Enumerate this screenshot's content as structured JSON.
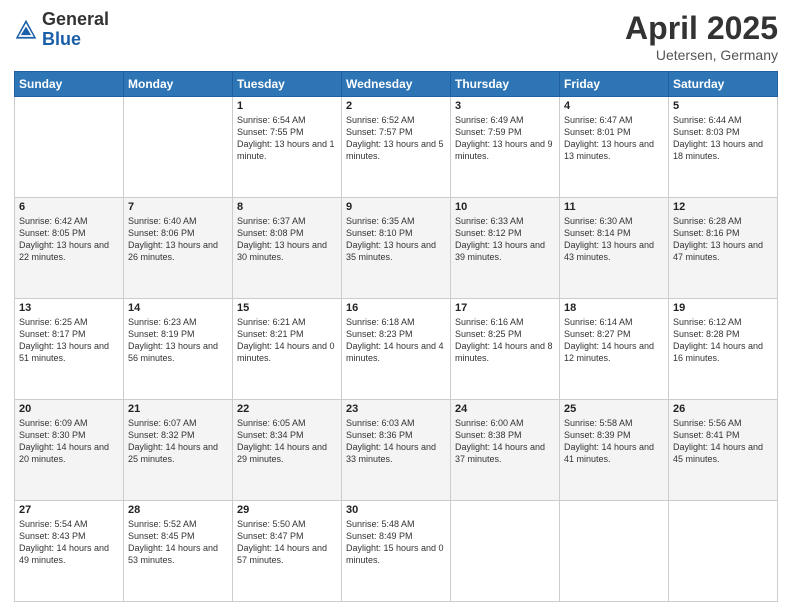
{
  "header": {
    "logo_general": "General",
    "logo_blue": "Blue",
    "title": "April 2025",
    "location": "Uetersen, Germany"
  },
  "weekdays": [
    "Sunday",
    "Monday",
    "Tuesday",
    "Wednesday",
    "Thursday",
    "Friday",
    "Saturday"
  ],
  "weeks": [
    [
      {
        "day": "",
        "info": ""
      },
      {
        "day": "",
        "info": ""
      },
      {
        "day": "1",
        "info": "Sunrise: 6:54 AM\nSunset: 7:55 PM\nDaylight: 13 hours and 1 minute."
      },
      {
        "day": "2",
        "info": "Sunrise: 6:52 AM\nSunset: 7:57 PM\nDaylight: 13 hours and 5 minutes."
      },
      {
        "day": "3",
        "info": "Sunrise: 6:49 AM\nSunset: 7:59 PM\nDaylight: 13 hours and 9 minutes."
      },
      {
        "day": "4",
        "info": "Sunrise: 6:47 AM\nSunset: 8:01 PM\nDaylight: 13 hours and 13 minutes."
      },
      {
        "day": "5",
        "info": "Sunrise: 6:44 AM\nSunset: 8:03 PM\nDaylight: 13 hours and 18 minutes."
      }
    ],
    [
      {
        "day": "6",
        "info": "Sunrise: 6:42 AM\nSunset: 8:05 PM\nDaylight: 13 hours and 22 minutes."
      },
      {
        "day": "7",
        "info": "Sunrise: 6:40 AM\nSunset: 8:06 PM\nDaylight: 13 hours and 26 minutes."
      },
      {
        "day": "8",
        "info": "Sunrise: 6:37 AM\nSunset: 8:08 PM\nDaylight: 13 hours and 30 minutes."
      },
      {
        "day": "9",
        "info": "Sunrise: 6:35 AM\nSunset: 8:10 PM\nDaylight: 13 hours and 35 minutes."
      },
      {
        "day": "10",
        "info": "Sunrise: 6:33 AM\nSunset: 8:12 PM\nDaylight: 13 hours and 39 minutes."
      },
      {
        "day": "11",
        "info": "Sunrise: 6:30 AM\nSunset: 8:14 PM\nDaylight: 13 hours and 43 minutes."
      },
      {
        "day": "12",
        "info": "Sunrise: 6:28 AM\nSunset: 8:16 PM\nDaylight: 13 hours and 47 minutes."
      }
    ],
    [
      {
        "day": "13",
        "info": "Sunrise: 6:25 AM\nSunset: 8:17 PM\nDaylight: 13 hours and 51 minutes."
      },
      {
        "day": "14",
        "info": "Sunrise: 6:23 AM\nSunset: 8:19 PM\nDaylight: 13 hours and 56 minutes."
      },
      {
        "day": "15",
        "info": "Sunrise: 6:21 AM\nSunset: 8:21 PM\nDaylight: 14 hours and 0 minutes."
      },
      {
        "day": "16",
        "info": "Sunrise: 6:18 AM\nSunset: 8:23 PM\nDaylight: 14 hours and 4 minutes."
      },
      {
        "day": "17",
        "info": "Sunrise: 6:16 AM\nSunset: 8:25 PM\nDaylight: 14 hours and 8 minutes."
      },
      {
        "day": "18",
        "info": "Sunrise: 6:14 AM\nSunset: 8:27 PM\nDaylight: 14 hours and 12 minutes."
      },
      {
        "day": "19",
        "info": "Sunrise: 6:12 AM\nSunset: 8:28 PM\nDaylight: 14 hours and 16 minutes."
      }
    ],
    [
      {
        "day": "20",
        "info": "Sunrise: 6:09 AM\nSunset: 8:30 PM\nDaylight: 14 hours and 20 minutes."
      },
      {
        "day": "21",
        "info": "Sunrise: 6:07 AM\nSunset: 8:32 PM\nDaylight: 14 hours and 25 minutes."
      },
      {
        "day": "22",
        "info": "Sunrise: 6:05 AM\nSunset: 8:34 PM\nDaylight: 14 hours and 29 minutes."
      },
      {
        "day": "23",
        "info": "Sunrise: 6:03 AM\nSunset: 8:36 PM\nDaylight: 14 hours and 33 minutes."
      },
      {
        "day": "24",
        "info": "Sunrise: 6:00 AM\nSunset: 8:38 PM\nDaylight: 14 hours and 37 minutes."
      },
      {
        "day": "25",
        "info": "Sunrise: 5:58 AM\nSunset: 8:39 PM\nDaylight: 14 hours and 41 minutes."
      },
      {
        "day": "26",
        "info": "Sunrise: 5:56 AM\nSunset: 8:41 PM\nDaylight: 14 hours and 45 minutes."
      }
    ],
    [
      {
        "day": "27",
        "info": "Sunrise: 5:54 AM\nSunset: 8:43 PM\nDaylight: 14 hours and 49 minutes."
      },
      {
        "day": "28",
        "info": "Sunrise: 5:52 AM\nSunset: 8:45 PM\nDaylight: 14 hours and 53 minutes."
      },
      {
        "day": "29",
        "info": "Sunrise: 5:50 AM\nSunset: 8:47 PM\nDaylight: 14 hours and 57 minutes."
      },
      {
        "day": "30",
        "info": "Sunrise: 5:48 AM\nSunset: 8:49 PM\nDaylight: 15 hours and 0 minutes."
      },
      {
        "day": "",
        "info": ""
      },
      {
        "day": "",
        "info": ""
      },
      {
        "day": "",
        "info": ""
      }
    ]
  ]
}
